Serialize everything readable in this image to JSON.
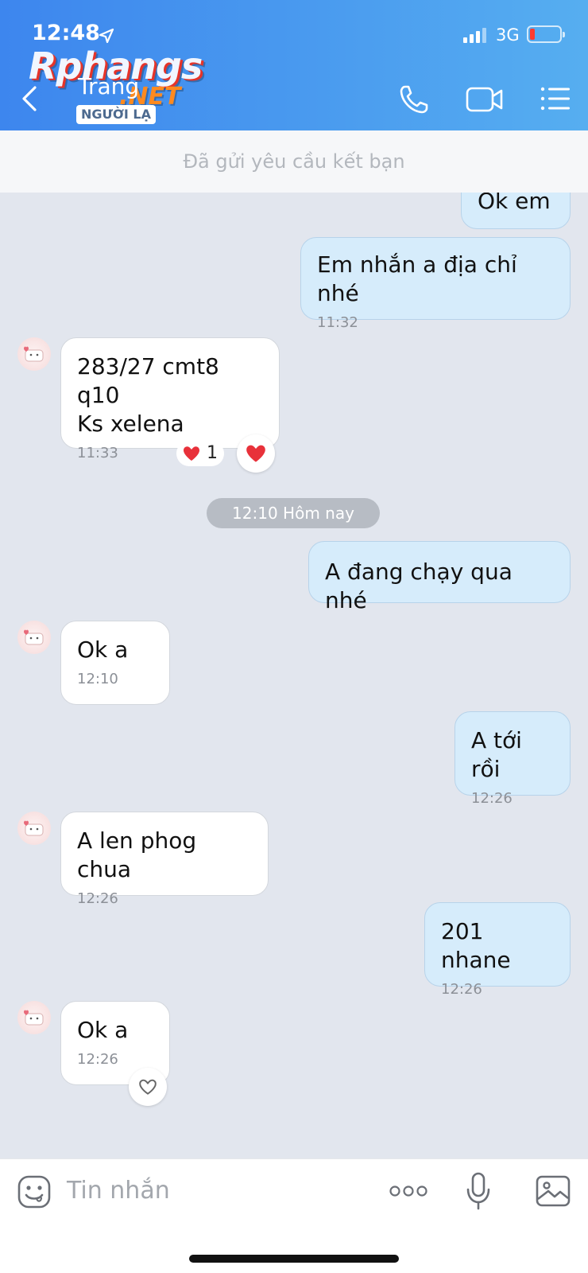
{
  "status_bar": {
    "time": "12:48",
    "network": "3G"
  },
  "watermark": {
    "brand": "Rphangs",
    "suffix": ".NET"
  },
  "header": {
    "contact_name": "Trang",
    "badge": "NGƯỜI LẠ"
  },
  "friend_request": {
    "text": "Đã gửi yêu cầu kết bạn"
  },
  "messages": [
    {
      "dir": "out",
      "text": "Ok em",
      "time": ""
    },
    {
      "dir": "out",
      "text": "Em nhắn a địa chỉ nhé",
      "time": "11:32"
    },
    {
      "dir": "in",
      "text": "283/27 cmt8 q10\nKs xelena",
      "time": "11:33",
      "reaction_count": "1"
    },
    {
      "dir": "out",
      "text": "A đang chạy qua nhé",
      "time": ""
    },
    {
      "dir": "in",
      "text": "Ok a",
      "time": "12:10"
    },
    {
      "dir": "out",
      "text": "A tới rồi",
      "time": "12:26"
    },
    {
      "dir": "in",
      "text": "A len phog chua",
      "time": "12:26"
    },
    {
      "dir": "out",
      "text": "201 nhane",
      "time": "12:26"
    },
    {
      "dir": "in",
      "text": "Ok a",
      "time": "12:26"
    }
  ],
  "date_separator": "12:10 Hôm nay",
  "composer": {
    "placeholder": "Tin nhắn"
  },
  "colors": {
    "header_start": "#3d86ee",
    "header_end": "#56aef0",
    "outgoing_bubble": "#d6ecfb",
    "incoming_bubble": "#ffffff",
    "reaction_heart": "#e8313a"
  },
  "icons": [
    "location-arrow-icon",
    "signal-icon",
    "battery-icon",
    "back-icon",
    "phone-icon",
    "video-call-icon",
    "menu-list-icon",
    "heart-icon",
    "emoji-icon",
    "more-icon",
    "microphone-icon",
    "image-icon"
  ]
}
